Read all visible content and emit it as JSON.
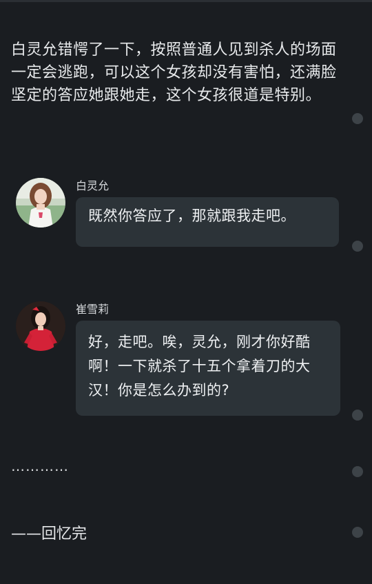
{
  "narration": {
    "text": "白灵允错愕了一下，按照普通人见到杀人的场面一定会逃跑，可以这个女孩却没有害怕，还满脸坚定的答应她跟她走，这个女孩很道是特别。"
  },
  "messages": [
    {
      "speaker": "白灵允",
      "text": "既然你答应了，那就跟我走吧。",
      "avatar": "avatar-girl-white"
    },
    {
      "speaker": "崔雪莉",
      "text": "好，走吧。唉，灵允，刚才你好酷啊！一下就杀了十五个拿着刀的大汉！你是怎么办到的?",
      "avatar": "avatar-girl-red"
    }
  ],
  "ellipsis": "…………",
  "footer": {
    "text": "——回忆完"
  },
  "colors": {
    "background": "#1a1d21",
    "bubble": "#2c3338",
    "dot": "#3d4348"
  }
}
